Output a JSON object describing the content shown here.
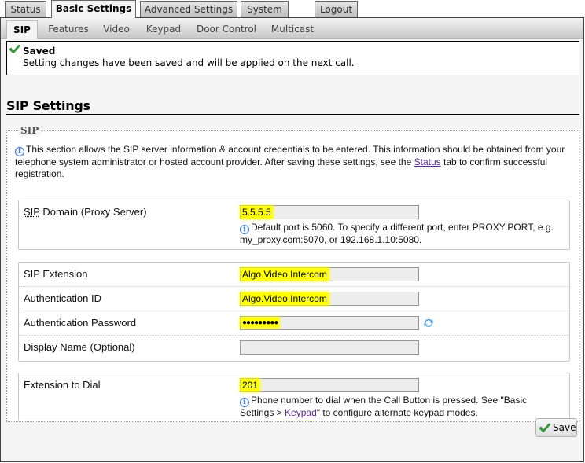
{
  "top_tabs": [
    {
      "label": "Status",
      "active": false
    },
    {
      "label": "Basic Settings",
      "active": true
    },
    {
      "label": "Advanced Settings",
      "active": false
    },
    {
      "label": "System",
      "active": false
    },
    {
      "label": "Logout",
      "active": false
    }
  ],
  "sub_tabs": [
    {
      "label": "SIP",
      "active": true
    },
    {
      "label": "Features",
      "active": false
    },
    {
      "label": "Video",
      "active": false
    },
    {
      "label": "Keypad",
      "active": false
    },
    {
      "label": "Door Control",
      "active": false
    },
    {
      "label": "Multicast",
      "active": false
    }
  ],
  "saved_notice": {
    "title": "Saved",
    "message": "Setting changes have been saved and will be applied on the next call."
  },
  "section_title": "SIP Settings",
  "fieldset": {
    "legend": "SIP",
    "info_before_link": "This section allows the SIP server information & account credentials to be entered. This information should be obtained from your telephone system administrator or hosted account provider. After saving these settings, see the ",
    "info_link": "Status",
    "info_after_link": " tab to confirm successful registration."
  },
  "fields": {
    "sip_domain": {
      "label_abbr": "SIP",
      "label_rest": " Domain (Proxy Server)",
      "value": "5.5.5.5",
      "help": "Default port is 5060. To specify a different port, enter PROXY:PORT, e.g. my_proxy.com:5070, or 192.168.1.10:5080."
    },
    "sip_extension": {
      "label": "SIP Extension",
      "value": "Algo.Video.Intercom"
    },
    "auth_id": {
      "label": "Authentication ID",
      "value": "Algo.Video.Intercom"
    },
    "auth_password": {
      "label": "Authentication Password",
      "value": "●●●●●●●●●"
    },
    "display_name": {
      "label": "Display Name (Optional)",
      "value": ""
    },
    "extension_to_dial": {
      "label": "Extension to Dial",
      "value": "201",
      "help_before_link": "Phone number to dial when the Call Button is pressed. See \"Basic Settings > ",
      "help_link": "Keypad",
      "help_after_link": "\" to configure alternate keypad modes."
    }
  },
  "save_button": {
    "label": "Save"
  },
  "colors": {
    "highlight": "#ffff00",
    "link": "#5a2a8a",
    "check": "#2fa53a",
    "info": "#3a6fc4"
  }
}
